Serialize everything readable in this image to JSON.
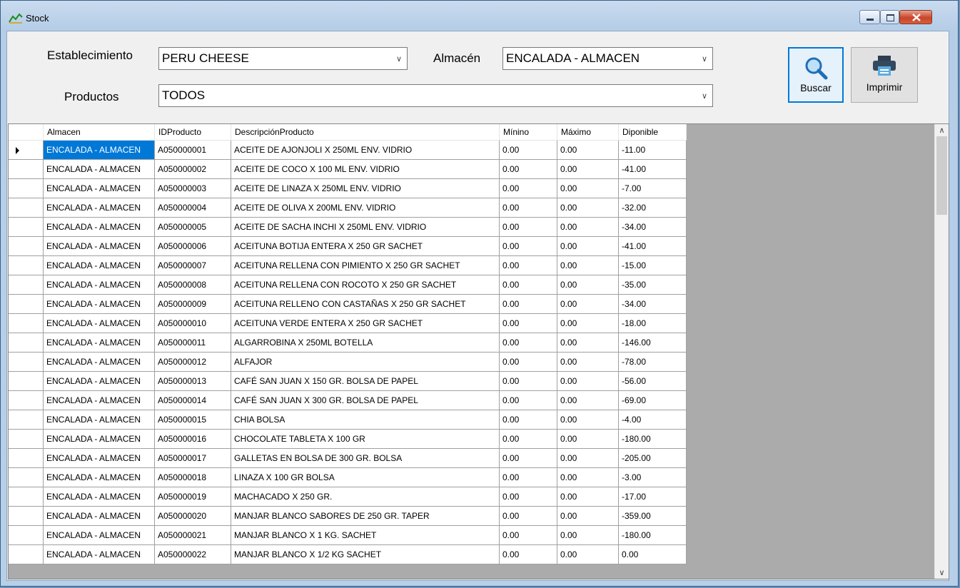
{
  "window": {
    "title": "Stock"
  },
  "filters": {
    "establecimiento_label": "Establecimiento",
    "establecimiento_value": "PERU CHEESE",
    "almacen_label": "Almacén",
    "almacen_value": "ENCALADA - ALMACEN",
    "productos_label": "Productos",
    "productos_value": "TODOS"
  },
  "toolbar": {
    "buscar_label": "Buscar",
    "imprimir_label": "Imprimir"
  },
  "grid": {
    "columns": [
      "Almacen",
      "IDProducto",
      "DescripciónProducto",
      "Mínino",
      "Máximo",
      "Diponible"
    ],
    "rows": [
      [
        "ENCALADA - ALMACEN",
        "A050000001",
        "ACEITE DE AJONJOLI X 250ML ENV. VIDRIO",
        "0.00",
        "0.00",
        "-11.00"
      ],
      [
        "ENCALADA - ALMACEN",
        "A050000002",
        "ACEITE DE COCO X 100 ML ENV. VIDRIO",
        "0.00",
        "0.00",
        "-41.00"
      ],
      [
        "ENCALADA - ALMACEN",
        "A050000003",
        "ACEITE DE LINAZA X 250ML ENV. VIDRIO",
        "0.00",
        "0.00",
        "-7.00"
      ],
      [
        "ENCALADA - ALMACEN",
        "A050000004",
        "ACEITE DE OLIVA X 200ML ENV. VIDRIO",
        "0.00",
        "0.00",
        "-32.00"
      ],
      [
        "ENCALADA - ALMACEN",
        "A050000005",
        "ACEITE DE SACHA INCHI X 250ML ENV. VIDRIO",
        "0.00",
        "0.00",
        "-34.00"
      ],
      [
        "ENCALADA - ALMACEN",
        "A050000006",
        "ACEITUNA BOTIJA ENTERA X 250 GR SACHET",
        "0.00",
        "0.00",
        "-41.00"
      ],
      [
        "ENCALADA - ALMACEN",
        "A050000007",
        "ACEITUNA RELLENA CON PIMIENTO X 250 GR SACHET",
        "0.00",
        "0.00",
        "-15.00"
      ],
      [
        "ENCALADA - ALMACEN",
        "A050000008",
        "ACEITUNA RELLENA CON ROCOTO X 250 GR SACHET",
        "0.00",
        "0.00",
        "-35.00"
      ],
      [
        "ENCALADA - ALMACEN",
        "A050000009",
        "ACEITUNA RELLENO CON CASTAÑAS X 250 GR SACHET",
        "0.00",
        "0.00",
        "-34.00"
      ],
      [
        "ENCALADA - ALMACEN",
        "A050000010",
        "ACEITUNA VERDE ENTERA X 250 GR SACHET",
        "0.00",
        "0.00",
        "-18.00"
      ],
      [
        "ENCALADA - ALMACEN",
        "A050000011",
        "ALGARROBINA  X 250ML BOTELLA",
        "0.00",
        "0.00",
        "-146.00"
      ],
      [
        "ENCALADA - ALMACEN",
        "A050000012",
        "ALFAJOR",
        "0.00",
        "0.00",
        "-78.00"
      ],
      [
        "ENCALADA - ALMACEN",
        "A050000013",
        "CAFÉ SAN JUAN X 150 GR. BOLSA DE PAPEL",
        "0.00",
        "0.00",
        "-56.00"
      ],
      [
        "ENCALADA - ALMACEN",
        "A050000014",
        "CAFÉ SAN JUAN X 300 GR. BOLSA DE PAPEL",
        "0.00",
        "0.00",
        "-69.00"
      ],
      [
        "ENCALADA - ALMACEN",
        "A050000015",
        "CHIA BOLSA",
        "0.00",
        "0.00",
        "-4.00"
      ],
      [
        "ENCALADA - ALMACEN",
        "A050000016",
        "CHOCOLATE TABLETA X 100 GR",
        "0.00",
        "0.00",
        "-180.00"
      ],
      [
        "ENCALADA - ALMACEN",
        "A050000017",
        "GALLETAS EN BOLSA DE 300 GR. BOLSA",
        "0.00",
        "0.00",
        "-205.00"
      ],
      [
        "ENCALADA - ALMACEN",
        "A050000018",
        "LINAZA X 100 GR BOLSA",
        "0.00",
        "0.00",
        "-3.00"
      ],
      [
        "ENCALADA - ALMACEN",
        "A050000019",
        "MACHACADO X 250 GR.",
        "0.00",
        "0.00",
        "-17.00"
      ],
      [
        "ENCALADA - ALMACEN",
        "A050000020",
        "MANJAR BLANCO SABORES DE 250 GR. TAPER",
        "0.00",
        "0.00",
        "-359.00"
      ],
      [
        "ENCALADA - ALMACEN",
        "A050000021",
        "MANJAR BLANCO X 1 KG. SACHET",
        "0.00",
        "0.00",
        "-180.00"
      ],
      [
        "ENCALADA - ALMACEN",
        "A050000022",
        "MANJAR BLANCO X 1/2 KG SACHET",
        "0.00",
        "0.00",
        "0.00"
      ]
    ]
  }
}
